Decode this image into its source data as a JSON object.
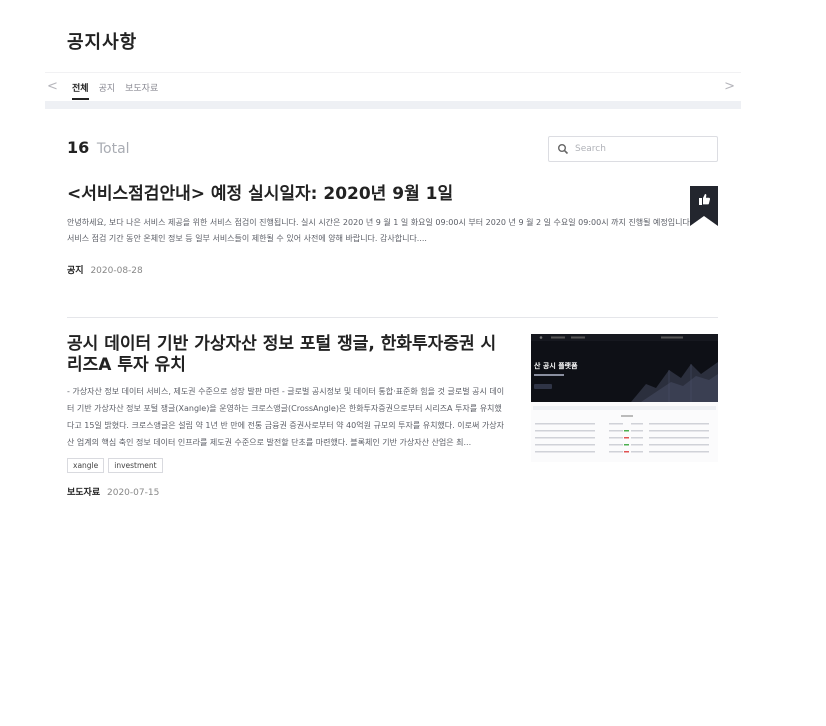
{
  "page": {
    "title": "공지사항"
  },
  "tabs": [
    {
      "label": "전체",
      "active": true
    },
    {
      "label": "공지",
      "active": false
    },
    {
      "label": "보도자료",
      "active": false
    }
  ],
  "summary": {
    "count": "16",
    "label": "Total"
  },
  "search": {
    "placeholder": "Search"
  },
  "posts": [
    {
      "title": "<서비스점검안내> 예정 실시일자: 2020년 9월 1일",
      "excerpt": "안녕하세요,   보다 나은 서비스 제공을 위한 서비스 점검이 진행됩니다. 실시 시간은 2020 년 9 월 1 일 화요일 09:00시 부터 2020 년 9 월 2 일 수요일 09:00시 까지 진행될 예정입니다. 서비스 점검 기간 동안 온체인 정보 등 일부 서비스들이 제한될 수 있어 사전에 양해 바랍니다.  감사합니다....",
      "category": "공지",
      "date": "2020-08-28"
    },
    {
      "title": "공시 데이터 기반 가상자산 정보 포털 쟁글, 한화투자증권 시리즈A 투자 유치",
      "excerpt": "- 가상자산 정보 데이터 서비스, 제도권 수준으로 성장 발판 마련 - 글로벌 공시정보 및 데이터 통합·표준화 힘을 것    글로벌 공시 데이터 기반 가상자산 정보 포털 쟁글(Xangle)을 운영하는 크로스앵글(CrossAngle)은 한화투자증권으로부터 시리즈A 투자를 유치했다고 15일 밝혔다. 크로스앵글은 설립 약 1년 반 만에 전통 금융권 증권사로부터 약 40억원 규모의 투자를 유치했다. 이로써 가상자산 업계의 핵심 축인 정보 데이터 인프라를 제도권 수준으로 발전할 단초를 마련했다.  블록체인 기반 가상자산 산업은 최...",
      "tags": [
        "xangle",
        "investment"
      ],
      "category": "보도자료",
      "date": "2020-07-15"
    }
  ],
  "thumbnail": {
    "headline": "산 공시 플랫폼"
  },
  "colors": {
    "bookmark": "#23262e",
    "text": "#222222",
    "muted": "#a9acb3",
    "thumb_dark": "#0e1016"
  }
}
